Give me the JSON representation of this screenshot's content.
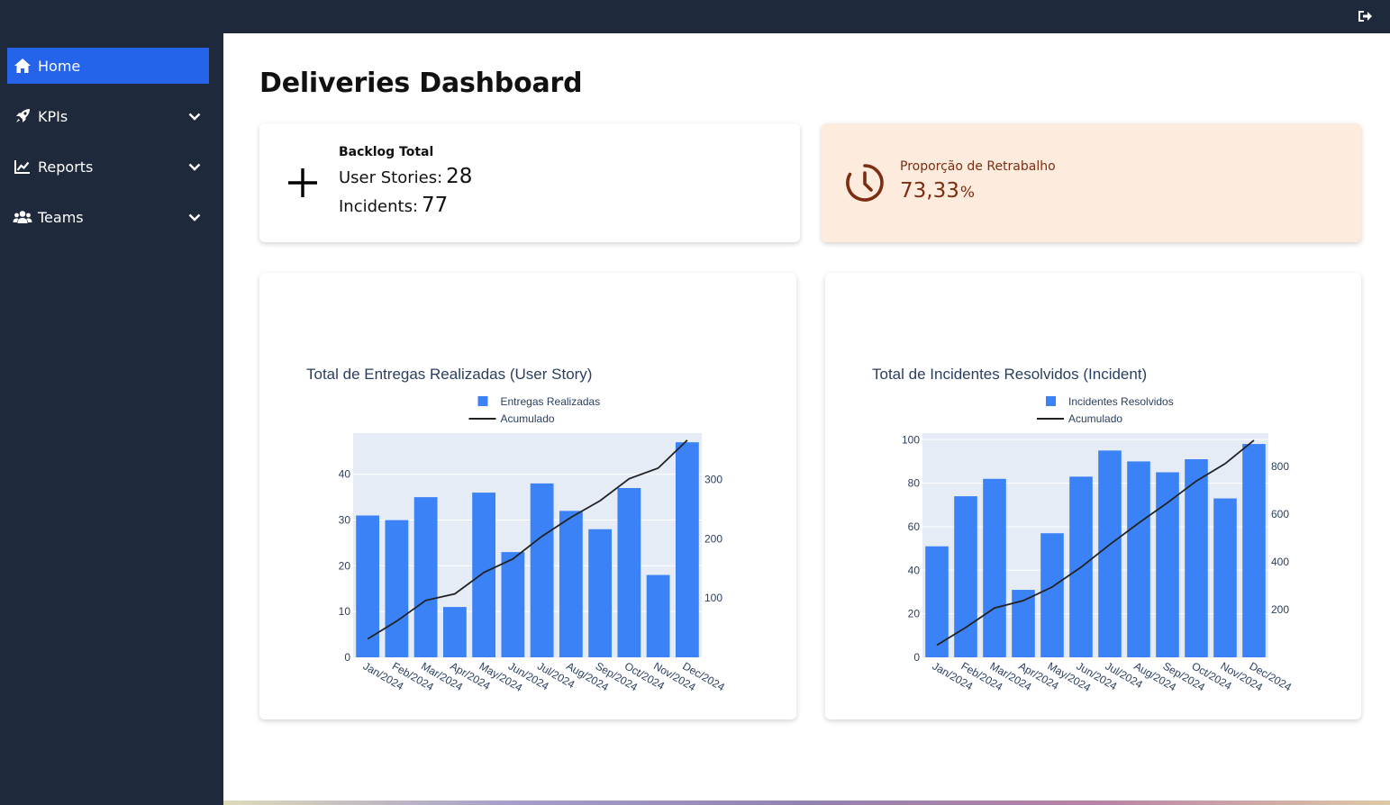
{
  "sidebar": {
    "items": [
      {
        "label": "Home",
        "icon": "home-icon",
        "active": true
      },
      {
        "label": "KPIs",
        "icon": "rocket-icon",
        "expandable": true
      },
      {
        "label": "Reports",
        "icon": "chart-line-icon",
        "expandable": true
      },
      {
        "label": "Teams",
        "icon": "users-icon",
        "expandable": true
      }
    ]
  },
  "topbar": {
    "logout_icon": "sign-out-icon"
  },
  "page": {
    "title": "Deliveries Dashboard"
  },
  "kpis": {
    "backlog": {
      "title": "Backlog Total",
      "user_stories_label": "User Stories:",
      "user_stories_value": "28",
      "incidents_label": "Incidents:",
      "incidents_value": "77",
      "icon": "plus-icon"
    },
    "rework": {
      "title": "Proporção de Retrabalho",
      "value": "73,33",
      "unit": "%",
      "icon": "clock-icon"
    }
  },
  "colors": {
    "accent": "#2563eb",
    "bar": "#3b82f6",
    "sidebar": "#1e293b",
    "plot_bg": "#e5ecf6",
    "rework_bg": "#fdebdd",
    "rework_text": "#7c2d12"
  },
  "chart_data": [
    {
      "type": "bar",
      "title": "Total de Entregas Realizadas (User Story)",
      "categories": [
        "Jan/2024",
        "Feb/2024",
        "Mar/2024",
        "Apr/2024",
        "May/2024",
        "Jun/2024",
        "Jul/2024",
        "Aug/2024",
        "Sep/2024",
        "Oct/2024",
        "Nov/2024",
        "Dec/2024"
      ],
      "series": [
        {
          "name": "Entregas Realizadas",
          "kind": "bar",
          "axis": "left",
          "values": [
            31,
            30,
            35,
            11,
            36,
            23,
            38,
            32,
            28,
            37,
            18,
            47
          ]
        },
        {
          "name": "Acumulado",
          "kind": "line",
          "axis": "right",
          "values": [
            31,
            61,
            96,
            107,
            143,
            166,
            204,
            236,
            264,
            301,
            319,
            366
          ]
        }
      ],
      "left_ticks": [
        0,
        10,
        20,
        30,
        40
      ],
      "right_ticks": [
        100,
        200,
        300
      ],
      "ylim_left": [
        0,
        49
      ],
      "ylim_right": [
        0,
        378
      ],
      "legend_position": "top"
    },
    {
      "type": "bar",
      "title": "Total de Incidentes Resolvidos (Incident)",
      "categories": [
        "Jan/2024",
        "Feb/2024",
        "Mar/2024",
        "Apr/2024",
        "May/2024",
        "Jun/2024",
        "Jul/2024",
        "Aug/2024",
        "Sep/2024",
        "Oct/2024",
        "Nov/2024",
        "Dec/2024"
      ],
      "series": [
        {
          "name": "Incidentes Resolvidos",
          "kind": "bar",
          "axis": "left",
          "values": [
            51,
            74,
            82,
            31,
            57,
            83,
            95,
            90,
            85,
            91,
            73,
            98
          ]
        },
        {
          "name": "Acumulado",
          "kind": "line",
          "axis": "right",
          "values": [
            51,
            125,
            207,
            238,
            295,
            378,
            473,
            563,
            648,
            739,
            812,
            910
          ]
        }
      ],
      "left_ticks": [
        0,
        20,
        40,
        60,
        80,
        100
      ],
      "right_ticks": [
        200,
        400,
        600,
        800
      ],
      "ylim_left": [
        0,
        103
      ],
      "ylim_right": [
        0,
        940
      ],
      "legend_position": "top"
    }
  ]
}
